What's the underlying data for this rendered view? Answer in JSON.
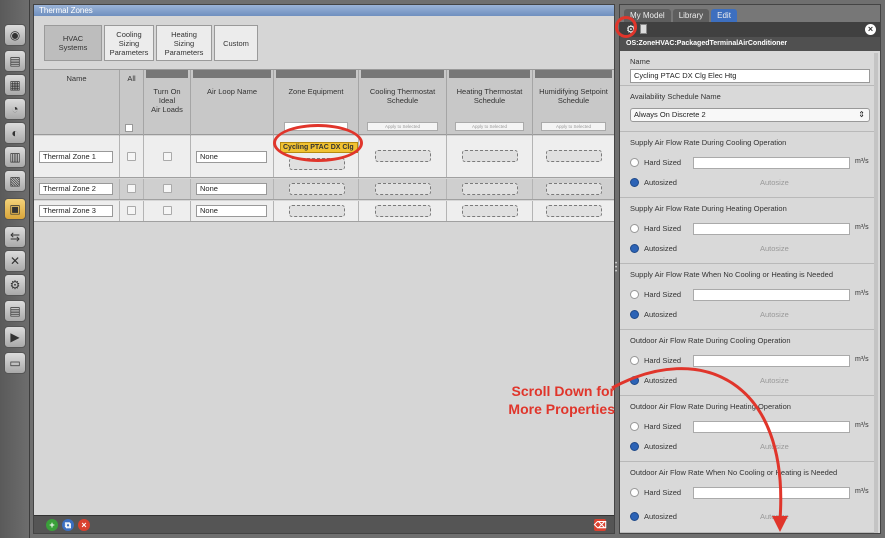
{
  "thermal_zones": {
    "title": "Thermal Zones",
    "tabs": [
      "HVAC\nSystems",
      "Cooling\nSizing\nParameters",
      "Heating\nSizing\nParameters",
      "Custom"
    ],
    "columns": {
      "name": "Name",
      "all": "All",
      "turn_on_ideal": "Turn On\nIdeal\nAir Loads",
      "air_loop": "Air Loop Name",
      "zone_equipment": "Zone Equipment",
      "cooling_thermostat": "Cooling Thermostat\nSchedule",
      "heating_thermostat": "Heating Thermostat\nSchedule",
      "humidifying": "Humidifying Setpoint\nSchedule"
    },
    "apply_label": "Apply to Selected",
    "rows": [
      {
        "name": "Thermal Zone 1",
        "air_loop": "None",
        "equipment": "Cycling PTAC DX Clg"
      },
      {
        "name": "Thermal Zone 2",
        "air_loop": "None",
        "equipment": ""
      },
      {
        "name": "Thermal Zone 3",
        "air_loop": "None",
        "equipment": ""
      }
    ]
  },
  "inspector": {
    "tabs": [
      "My Model",
      "Library",
      "Edit"
    ],
    "active_tab": "Edit",
    "class_name": "OS:ZoneHVAC:PackagedTerminalAirConditioner",
    "name_label": "Name",
    "name_value": "Cycling PTAC DX Clg Elec Htg",
    "availability_label": "Availability Schedule Name",
    "availability_value": "Always On Discrete 2",
    "hard_sized_label": "Hard Sized",
    "autosized_label": "Autosized",
    "autosize_text": "Autosize",
    "unit": "m³/s",
    "fields": [
      "Supply Air Flow Rate During Cooling Operation",
      "Supply Air Flow Rate During Heating Operation",
      "Supply Air Flow Rate When No Cooling or Heating is Needed",
      "Outdoor Air Flow Rate During Cooling Operation",
      "Outdoor Air Flow Rate During Heating Operation",
      "Outdoor Air Flow Rate When No Cooling or Heating is Needed"
    ]
  },
  "annotation": {
    "text": "Scroll Down for\nMore Properties",
    "color": "#e0352b"
  }
}
